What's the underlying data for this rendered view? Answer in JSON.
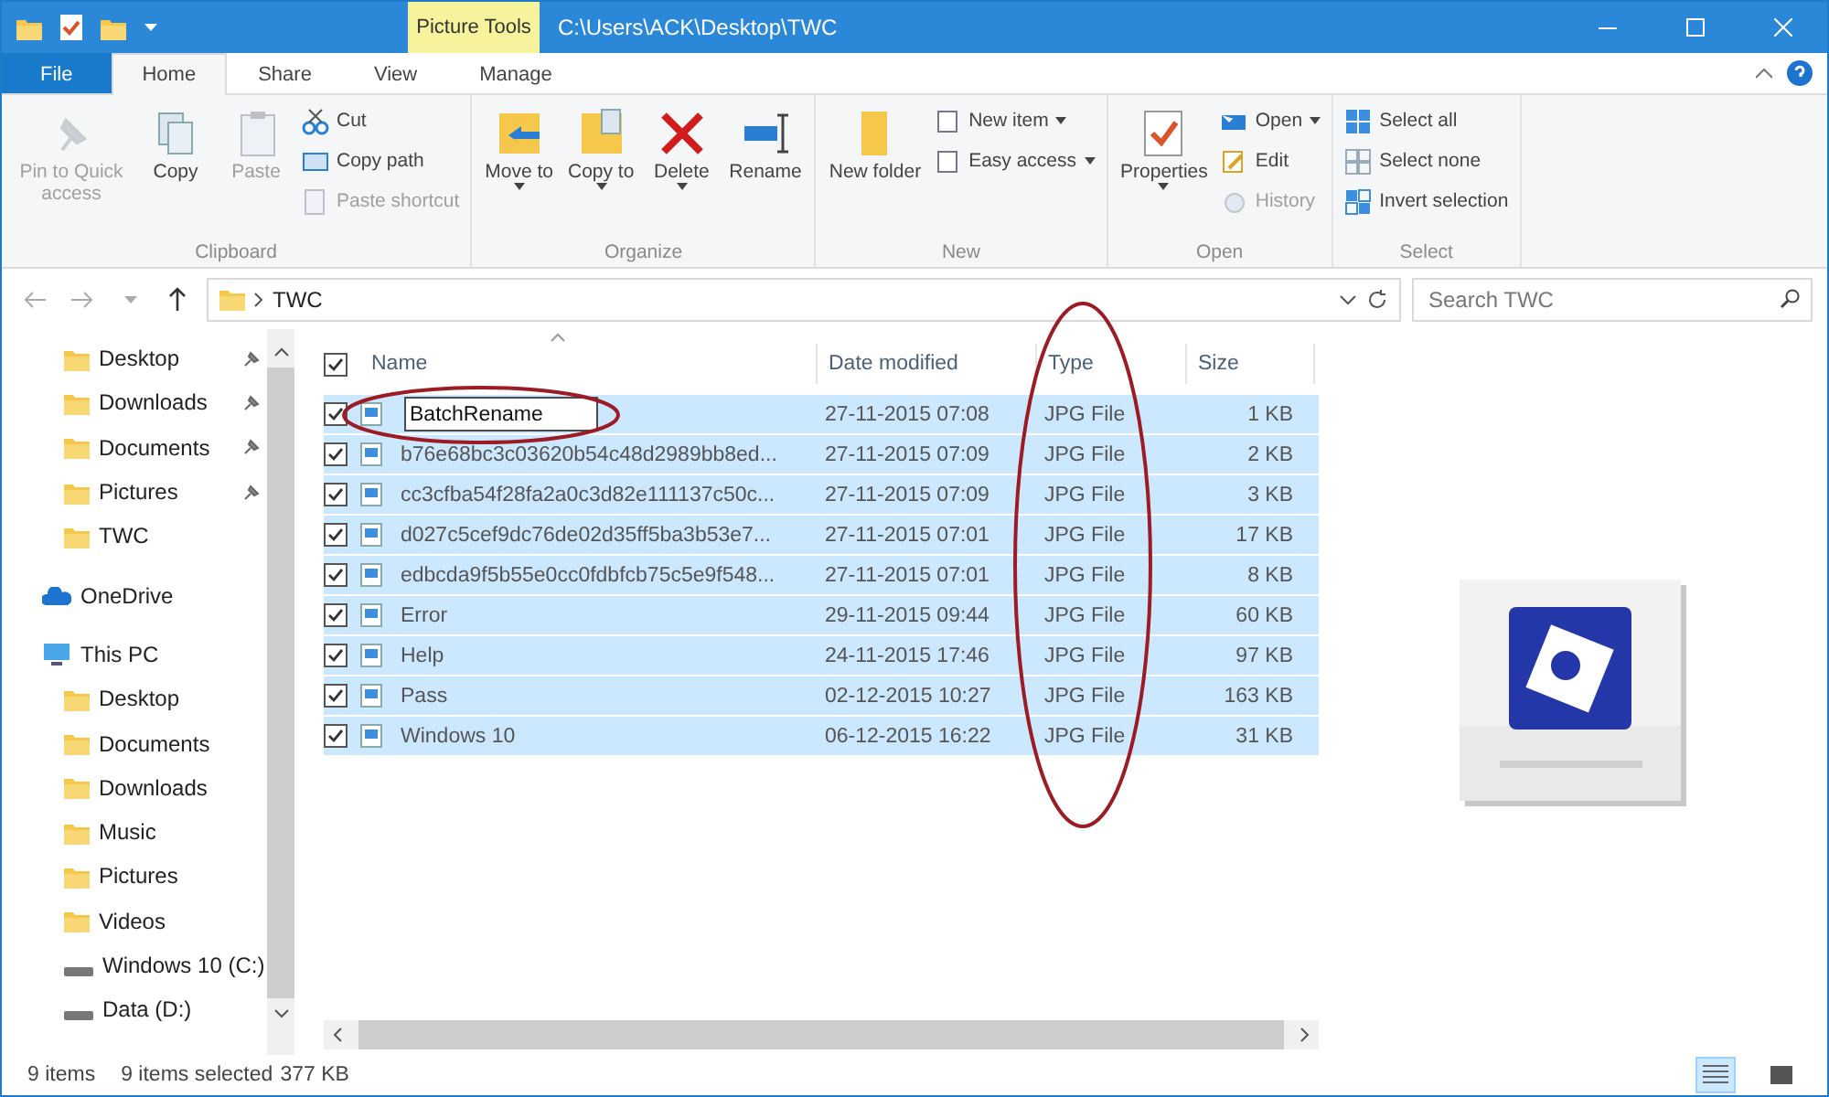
{
  "title_bar": {
    "contextual_tab": "Picture Tools",
    "path": "C:\\Users\\ACK\\Desktop\\TWC"
  },
  "ribbon_tabs": [
    {
      "label": "File",
      "kind": "file",
      "selected": false
    },
    {
      "label": "Home",
      "kind": "tab",
      "selected": true
    },
    {
      "label": "Share",
      "kind": "tab",
      "selected": false
    },
    {
      "label": "View",
      "kind": "tab",
      "selected": false
    },
    {
      "label": "Manage",
      "kind": "contextual",
      "selected": false
    }
  ],
  "ribbon": {
    "groups": [
      {
        "label": "Clipboard",
        "buttons": [
          {
            "label": "Pin to Quick access",
            "kind": "large",
            "disabled": true,
            "dropdown": false
          },
          {
            "label": "Copy",
            "kind": "large",
            "disabled": false,
            "dropdown": false
          },
          {
            "label": "Paste",
            "kind": "large",
            "disabled": true,
            "dropdown": false
          },
          {
            "label": "Cut",
            "kind": "small",
            "disabled": false,
            "dropdown": false
          },
          {
            "label": "Copy path",
            "kind": "small",
            "disabled": false,
            "dropdown": false
          },
          {
            "label": "Paste shortcut",
            "kind": "small",
            "disabled": true,
            "dropdown": false
          }
        ]
      },
      {
        "label": "Organize",
        "buttons": [
          {
            "label": "Move to",
            "kind": "large",
            "disabled": false,
            "dropdown": true
          },
          {
            "label": "Copy to",
            "kind": "large",
            "disabled": false,
            "dropdown": true
          },
          {
            "label": "Delete",
            "kind": "large",
            "disabled": false,
            "dropdown": true
          },
          {
            "label": "Rename",
            "kind": "large",
            "disabled": false,
            "dropdown": false
          }
        ]
      },
      {
        "label": "New",
        "buttons": [
          {
            "label": "New folder",
            "kind": "large",
            "disabled": false,
            "dropdown": false
          },
          {
            "label": "New item",
            "kind": "small",
            "disabled": false,
            "dropdown": true
          },
          {
            "label": "Easy access",
            "kind": "small",
            "disabled": false,
            "dropdown": true
          }
        ]
      },
      {
        "label": "Open",
        "buttons": [
          {
            "label": "Properties",
            "kind": "large",
            "disabled": false,
            "dropdown": true
          },
          {
            "label": "Open",
            "kind": "small",
            "disabled": false,
            "dropdown": true
          },
          {
            "label": "Edit",
            "kind": "small",
            "disabled": false,
            "dropdown": false
          },
          {
            "label": "History",
            "kind": "small",
            "disabled": true,
            "dropdown": false
          }
        ]
      },
      {
        "label": "Select",
        "buttons": [
          {
            "label": "Select all",
            "kind": "small",
            "disabled": false,
            "dropdown": false
          },
          {
            "label": "Select none",
            "kind": "small",
            "disabled": false,
            "dropdown": false
          },
          {
            "label": "Invert selection",
            "kind": "small",
            "disabled": false,
            "dropdown": false
          }
        ]
      }
    ]
  },
  "address": {
    "crumbs": [
      "TWC"
    ]
  },
  "search": {
    "placeholder": "Search TWC"
  },
  "sidebar": {
    "quick_access": [
      {
        "label": "Desktop",
        "pinned": true
      },
      {
        "label": "Downloads",
        "pinned": true
      },
      {
        "label": "Documents",
        "pinned": true
      },
      {
        "label": "Pictures",
        "pinned": true
      },
      {
        "label": "TWC",
        "pinned": false
      }
    ],
    "items": [
      {
        "label": "OneDrive",
        "kind": "cloud"
      },
      {
        "label": "This PC",
        "kind": "pc",
        "children": [
          {
            "label": "Desktop",
            "kind": "folder"
          },
          {
            "label": "Documents",
            "kind": "folder"
          },
          {
            "label": "Downloads",
            "kind": "folder"
          },
          {
            "label": "Music",
            "kind": "folder"
          },
          {
            "label": "Pictures",
            "kind": "folder"
          },
          {
            "label": "Videos",
            "kind": "folder"
          },
          {
            "label": "Windows 10 (C:)",
            "kind": "drive"
          },
          {
            "label": "Data (D:)",
            "kind": "drive"
          }
        ]
      }
    ]
  },
  "files": {
    "all_checked": true,
    "columns": [
      "Name",
      "Date modified",
      "Type",
      "Size"
    ],
    "rows": [
      {
        "name": "BatchRename",
        "date": "27-11-2015 07:08",
        "type": "JPG File",
        "size": "1 KB",
        "checked": true,
        "selected": true,
        "editing": true
      },
      {
        "name": "b76e68bc3c03620b54c48d2989bb8ed...",
        "date": "27-11-2015 07:09",
        "type": "JPG File",
        "size": "2 KB",
        "checked": true,
        "selected": true,
        "editing": false
      },
      {
        "name": "cc3cfba54f28fa2a0c3d82e111137c50c...",
        "date": "27-11-2015 07:09",
        "type": "JPG File",
        "size": "3 KB",
        "checked": true,
        "selected": true,
        "editing": false
      },
      {
        "name": "d027c5cef9dc76de02d35ff5ba3b53e7...",
        "date": "27-11-2015 07:01",
        "type": "JPG File",
        "size": "17 KB",
        "checked": true,
        "selected": true,
        "editing": false
      },
      {
        "name": "edbcda9f5b55e0cc0fdbfcb75c5e9f548...",
        "date": "27-11-2015 07:01",
        "type": "JPG File",
        "size": "8 KB",
        "checked": true,
        "selected": true,
        "editing": false
      },
      {
        "name": "Error",
        "date": "29-11-2015 09:44",
        "type": "JPG File",
        "size": "60 KB",
        "checked": true,
        "selected": true,
        "editing": false
      },
      {
        "name": "Help",
        "date": "24-11-2015 17:46",
        "type": "JPG File",
        "size": "97 KB",
        "checked": true,
        "selected": true,
        "editing": false
      },
      {
        "name": "Pass",
        "date": "02-12-2015 10:27",
        "type": "JPG File",
        "size": "163 KB",
        "checked": true,
        "selected": true,
        "editing": false
      },
      {
        "name": "Windows 10",
        "date": "06-12-2015 16:22",
        "type": "JPG File",
        "size": "31 KB",
        "checked": true,
        "selected": true,
        "editing": false
      }
    ]
  },
  "status_bar": {
    "count": "9 items",
    "selection": "9 items selected",
    "size": "377 KB",
    "views": [
      {
        "kind": "details",
        "selected": true
      },
      {
        "kind": "large",
        "selected": false
      }
    ]
  },
  "annotations": [
    {
      "kind": "ellipse"
    },
    {
      "kind": "ellipse"
    }
  ]
}
